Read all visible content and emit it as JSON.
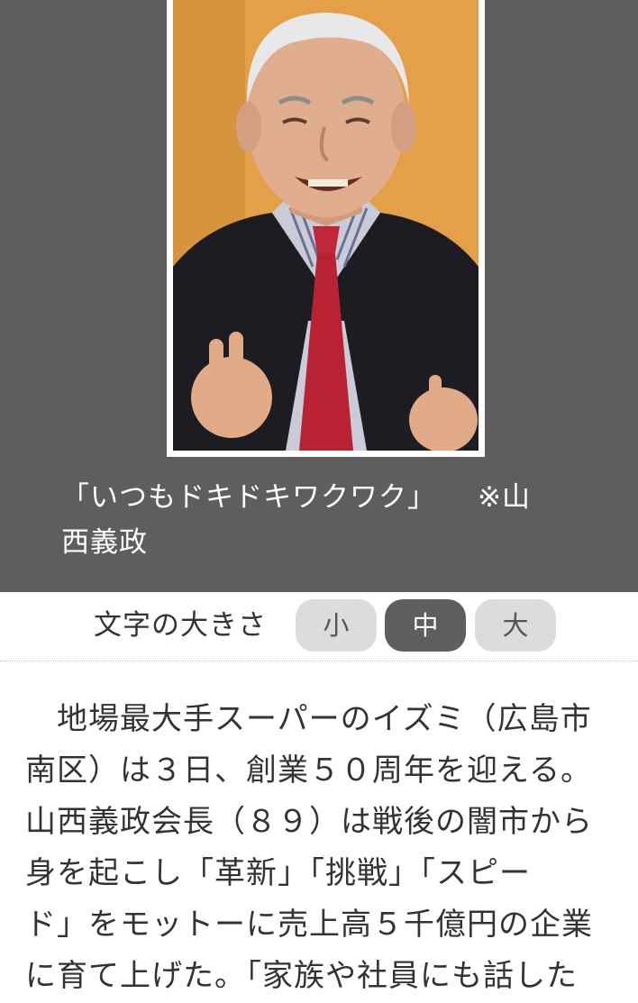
{
  "photo": {
    "caption_title": "「いつもドキドキワクワク」",
    "caption_note": "※山",
    "caption_note_cont": "西義政"
  },
  "font_size_control": {
    "label": "文字の大きさ",
    "options": [
      "小",
      "中",
      "大"
    ],
    "selected": "中"
  },
  "article": {
    "lines": [
      "　地場最大手スーパーのイズミ（広島市",
      "南区）は３日、創業５０周年を迎える。",
      "山西義政会長（８９）は戦後の闇市から",
      "身を起こし「革新」「挑戦」「スピー",
      "ド」をモットーに売上高５千億円の企業",
      "に育て上げた。「家族や社員にも話した"
    ]
  },
  "colors": {
    "photo_background": "#5e5e5e",
    "selected_button": "#5e5e5e",
    "unselected_button": "#dcdcdc",
    "text": "#333333"
  }
}
